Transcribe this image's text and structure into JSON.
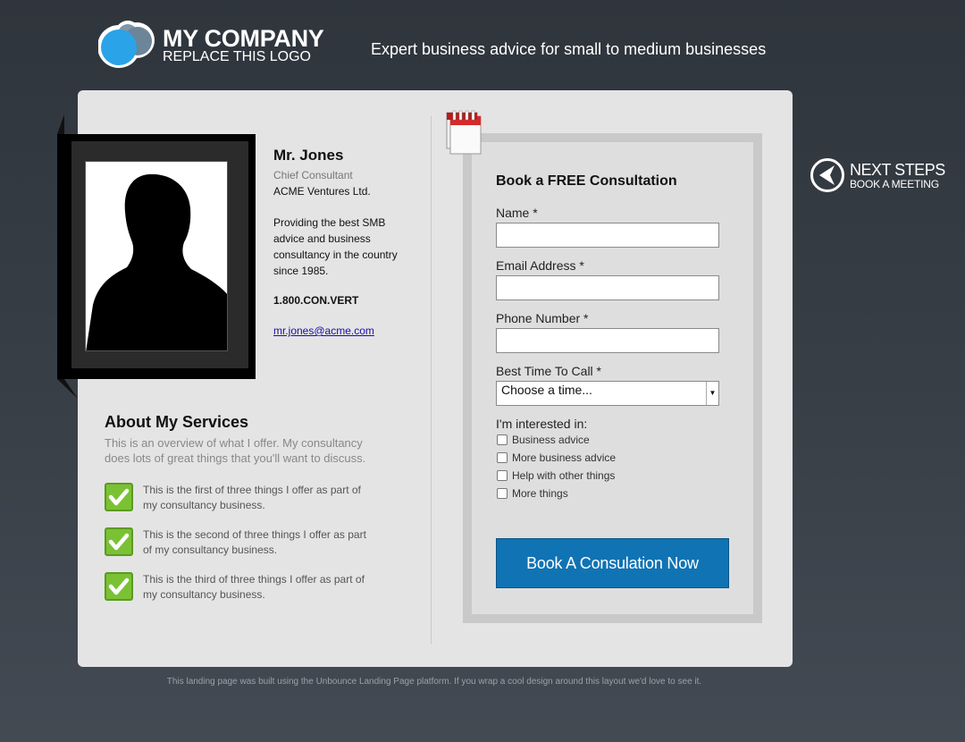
{
  "header": {
    "brand_name": "MY COMPANY",
    "brand_sub": "REPLACE THIS LOGO",
    "tagline": "Expert business advice for small to medium businesses"
  },
  "profile": {
    "name": "Mr. Jones",
    "title": "Chief Consultant",
    "company": "ACME Ventures Ltd.",
    "description": "Providing the best SMB advice and business consultancy in the country since 1985.",
    "phone": "1.800.CON.VERT",
    "email": "mr.jones@acme.com"
  },
  "about": {
    "heading": "About My Services",
    "intro": "This is an overview of what I offer. My consultancy does lots of great things that you'll want to discuss.",
    "services": [
      "This is the first of three things I offer as part of my consultancy business.",
      "This is the second of three things I offer as part of my consultancy business.",
      "This is the third of three things I offer as part of my consultancy business."
    ]
  },
  "form": {
    "title": "Book a FREE Consultation",
    "name_label": "Name *",
    "name_value": "",
    "email_label": "Email Address *",
    "email_value": "",
    "phone_label": "Phone Number *",
    "phone_value": "",
    "time_label": "Best Time To Call *",
    "time_selected": "Choose a time...",
    "interest_label": "I'm interested in:",
    "interests": [
      "Business advice",
      "More business advice",
      "Help with other things",
      "More things"
    ],
    "submit_label": "Book A Consulation Now"
  },
  "next_steps": {
    "title": "NEXT STEPS",
    "subtitle": "BOOK A MEETING"
  },
  "footer": {
    "text": "This landing page was built using the Unbounce Landing Page platform. If you wrap a cool design around this layout we'd love to see it."
  },
  "colors": {
    "accent": "#1073b4",
    "check_green": "#7ac234",
    "logo_blue": "#2aa3e8"
  }
}
